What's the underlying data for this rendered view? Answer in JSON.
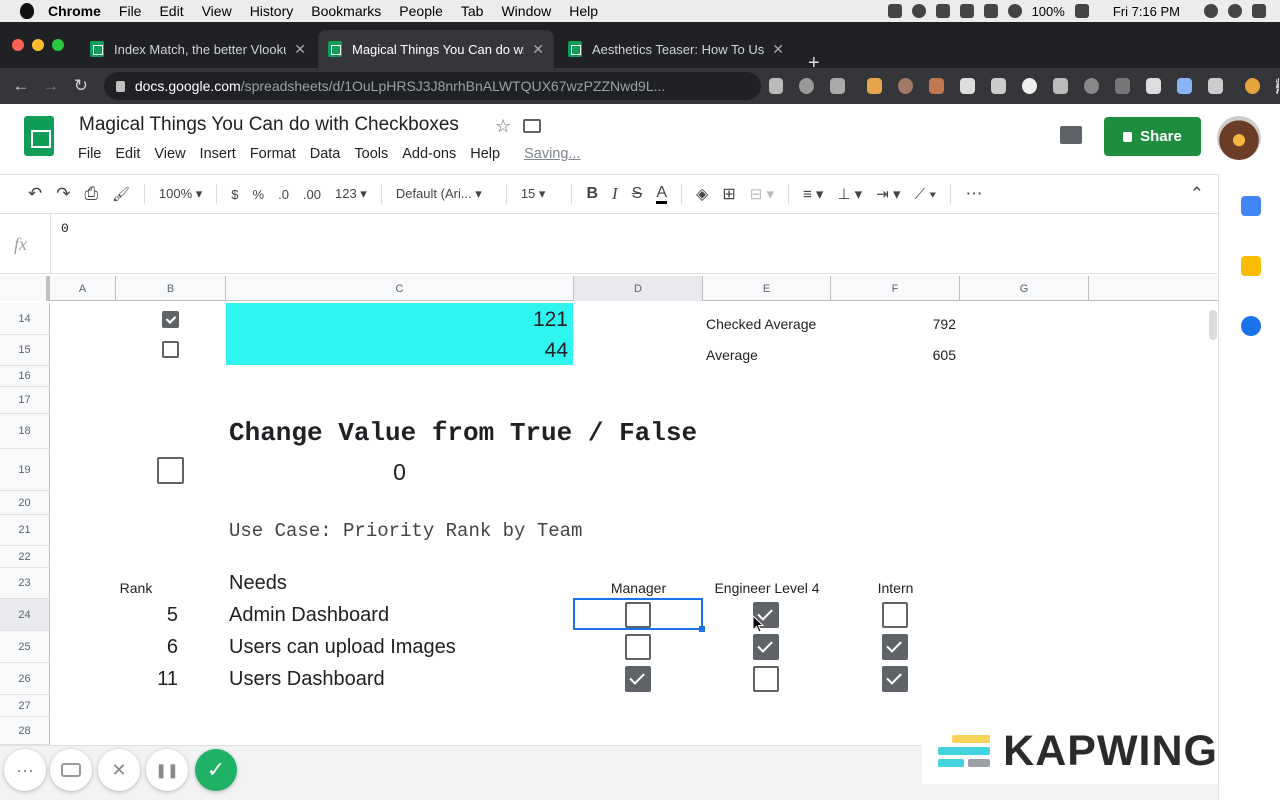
{
  "menubar": {
    "app": "Chrome",
    "items": [
      "File",
      "Edit",
      "View",
      "History",
      "Bookmarks",
      "People",
      "Tab",
      "Window",
      "Help"
    ],
    "battery": "100%",
    "clock": "Fri 7:16 PM"
  },
  "tabs": [
    {
      "label": "Index Match, the better Vlooku",
      "close": "✕"
    },
    {
      "label": "Magical Things You Can do with",
      "close": "✕"
    },
    {
      "label": "Aesthetics Teaser: How To Use",
      "close": "✕"
    }
  ],
  "newtab": "+",
  "nav": {
    "back": "←",
    "forward": "→",
    "reload": "↻",
    "host": "docs.google.com",
    "path": "/spreadsheets/d/1OuLpHRSJ3J8nrhBnALWTQUX67wzPZZNwd9L..."
  },
  "doc": {
    "title": "Magical Things You Can do with Checkboxes",
    "star": "☆",
    "menu": [
      "File",
      "Edit",
      "View",
      "Insert",
      "Format",
      "Data",
      "Tools",
      "Add-ons",
      "Help"
    ],
    "saving": "Saving...",
    "share": "Share"
  },
  "toolbar": {
    "undo": "↶",
    "redo": "↷",
    "print": "⎙",
    "paint": "🖌",
    "zoom": "100%  ▾",
    "currency": "$",
    "percent": "%",
    "dec_less": ".0",
    "dec_more": ".00",
    "format": "123 ▾",
    "font": "Default (Ari...  ▾",
    "size": "15  ▾",
    "bold": "B",
    "italic": "I",
    "strike": "S",
    "color": "A",
    "fill": "◈",
    "borders": "⊞",
    "merge": "⊟  ▾",
    "halign": "≡  ▾",
    "valign": "⊥  ▾",
    "wrap": "⇥  ▾",
    "rotate": "⟋  ▾",
    "more": "⋯",
    "collapse": "⌃"
  },
  "formula": {
    "label": "fx",
    "value": "0"
  },
  "columns": [
    "A",
    "B",
    "C",
    "D",
    "E",
    "F",
    "G"
  ],
  "rows": [
    "14",
    "15",
    "16",
    "17",
    "18",
    "19",
    "20",
    "21",
    "22",
    "23",
    "24",
    "25",
    "26",
    "27",
    "28"
  ],
  "sheet": {
    "c14": "121",
    "c15": "44",
    "e14": "Checked Average",
    "f14": "792",
    "e15": "Average",
    "f15": "605",
    "heading": "Change Value from True / False",
    "c19": "0",
    "usecase": "Use Case: Priority Rank by Team",
    "rank_header": "Rank",
    "needs_header": "Needs",
    "manager_header": "Manager",
    "engineer_header": "Engineer Level 4",
    "intern_header": "Intern",
    "items": [
      {
        "rank": "5",
        "need": "Admin Dashboard",
        "manager": false,
        "engineer": true,
        "intern": false
      },
      {
        "rank": "6",
        "need": "Users can upload Images",
        "manager": false,
        "engineer": true,
        "intern": true
      },
      {
        "rank": "11",
        "need": "Users Dashboard",
        "manager": true,
        "engineer": false,
        "intern": true
      }
    ],
    "b14": true,
    "b15": false,
    "b19": false
  },
  "overlay": {
    "more": "···",
    "cancel": "✕",
    "pause": "❚❚",
    "confirm": "✓"
  },
  "watermark": "KAPWING"
}
